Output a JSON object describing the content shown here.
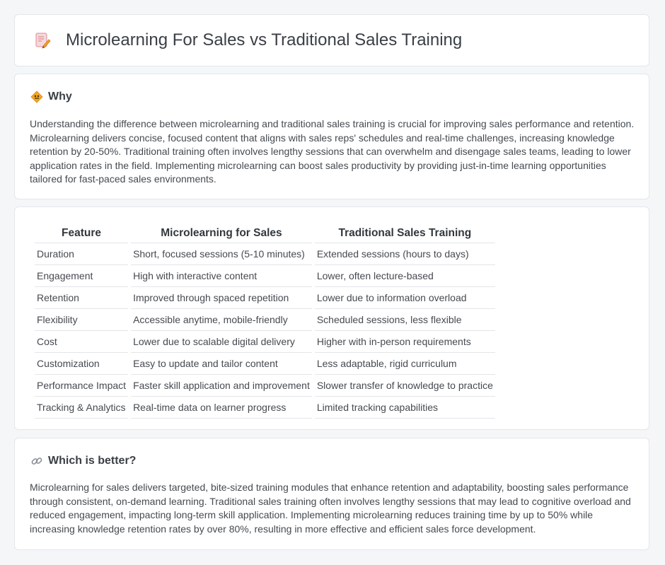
{
  "header": {
    "title": "Microlearning For Sales vs Traditional Sales Training",
    "icon": "document-pencil-icon"
  },
  "why": {
    "icon": "diamond-sign-icon",
    "title": "Why",
    "body": "Understanding the difference between microlearning and traditional sales training is crucial for improving sales performance and retention. Microlearning delivers concise, focused content that aligns with sales reps' schedules and real-time challenges, increasing knowledge retention by 20-50%. Traditional training often involves lengthy sessions that can overwhelm and disengage sales teams, leading to lower application rates in the field. Implementing microlearning can boost sales productivity by providing just-in-time learning opportunities tailored for fast-paced sales environments."
  },
  "table": {
    "headers": [
      "Feature",
      "Microlearning for Sales",
      "Traditional Sales Training"
    ],
    "rows": [
      [
        "Duration",
        "Short, focused sessions (5-10 minutes)",
        "Extended sessions (hours to days)"
      ],
      [
        "Engagement",
        "High with interactive content",
        "Lower, often lecture-based"
      ],
      [
        "Retention",
        "Improved through spaced repetition",
        "Lower due to information overload"
      ],
      [
        "Flexibility",
        "Accessible anytime, mobile-friendly",
        "Scheduled sessions, less flexible"
      ],
      [
        "Cost",
        "Lower due to scalable digital delivery",
        "Higher with in-person requirements"
      ],
      [
        "Customization",
        "Easy to update and tailor content",
        "Less adaptable, rigid curriculum"
      ],
      [
        "Performance Impact",
        "Faster skill application and improvement",
        "Slower transfer of knowledge to practice"
      ],
      [
        "Tracking & Analytics",
        "Real-time data on learner progress",
        "Limited tracking capabilities"
      ]
    ]
  },
  "which": {
    "icon": "link-icon",
    "title": "Which is better?",
    "body": "Microlearning for sales delivers targeted, bite-sized training modules that enhance retention and adaptability, boosting sales performance through consistent, on-demand learning. Traditional sales training often involves lengthy sessions that may lead to cognitive overload and reduced engagement, impacting long-term skill application. Implementing microlearning reduces training time by up to 50% while increasing knowledge retention rates by over 80%, resulting in more effective and efficient sales force development."
  },
  "colors": {
    "background": "#f5f6f8",
    "card": "#ffffff",
    "border": "#e3e6ea",
    "accent_orange": "#f0a030",
    "accent_pink": "#e8788a"
  }
}
